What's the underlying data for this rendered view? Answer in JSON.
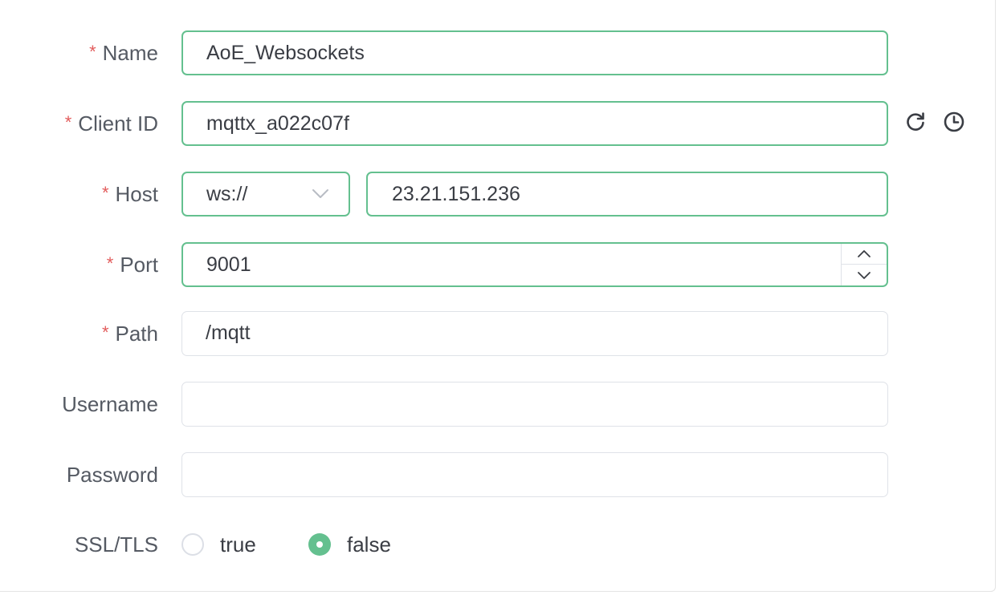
{
  "form": {
    "name": {
      "label": "Name",
      "required": true,
      "value": "AoE_Websockets"
    },
    "client_id": {
      "label": "Client ID",
      "required": true,
      "value": "mqttx_a022c07f",
      "refresh_icon": "refresh-icon",
      "history_icon": "clock-icon"
    },
    "host": {
      "label": "Host",
      "required": true,
      "protocol": "ws://",
      "value": "23.21.151.236"
    },
    "port": {
      "label": "Port",
      "required": true,
      "value": "9001"
    },
    "path": {
      "label": "Path",
      "required": true,
      "value": "/mqtt"
    },
    "username": {
      "label": "Username",
      "required": false,
      "value": ""
    },
    "password": {
      "label": "Password",
      "required": false,
      "value": ""
    },
    "ssl_tls": {
      "label": "SSL/TLS",
      "options": [
        "true",
        "false"
      ],
      "selected": "false"
    }
  },
  "required_mark": "*",
  "colors": {
    "accent": "#64c08f",
    "required": "#e25c5c",
    "label": "#555a63",
    "border_default": "#dfe2e8"
  }
}
